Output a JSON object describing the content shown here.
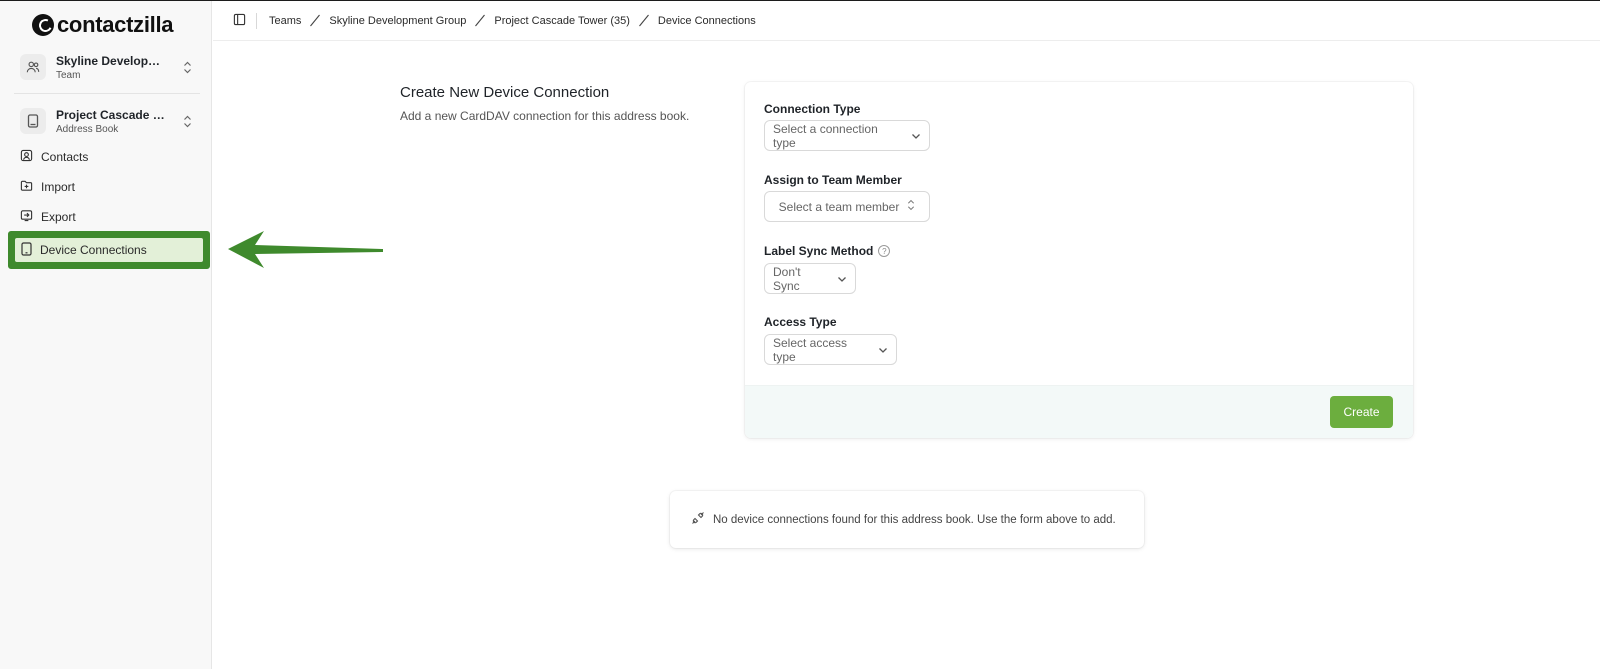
{
  "app": {
    "logo_text": "contactzilla"
  },
  "sidebar": {
    "team_switcher": {
      "title": "Skyline Developmen...",
      "subtitle": "Team"
    },
    "book_switcher": {
      "title": "Project Cascade Tow...",
      "subtitle": "Address Book"
    },
    "items": [
      {
        "label": "Contacts",
        "icon": "contacts-icon"
      },
      {
        "label": "Import",
        "icon": "import-icon"
      },
      {
        "label": "Export",
        "icon": "export-icon"
      },
      {
        "label": "Device Connections",
        "icon": "device-icon",
        "active": true
      }
    ]
  },
  "breadcrumb": {
    "items": [
      "Teams",
      "Skyline Development Group",
      "Project Cascade Tower (35)",
      "Device Connections"
    ]
  },
  "form": {
    "title": "Create New Device Connection",
    "description": "Add a new CardDAV connection for this address book.",
    "connection_type": {
      "label": "Connection Type",
      "placeholder": "Select a connection type"
    },
    "team_member": {
      "label": "Assign to Team Member",
      "placeholder": "Select a team member"
    },
    "label_sync": {
      "label": "Label Sync Method",
      "value": "Don't Sync"
    },
    "access_type": {
      "label": "Access Type",
      "placeholder": "Select access type"
    },
    "create_label": "Create"
  },
  "empty_state": {
    "text": "No device connections found for this address book. Use the form above to add."
  },
  "colors": {
    "accent": "#6cae3e",
    "highlight_border": "#3f8a2d",
    "highlight_fill": "#e3f0d8",
    "arrow": "#3f8a2d"
  }
}
